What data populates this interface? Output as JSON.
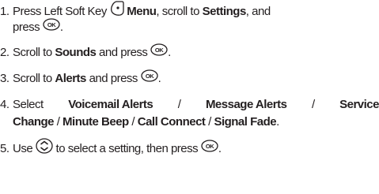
{
  "steps": [
    {
      "num": "1.",
      "t1": "Press Left Soft Key",
      "t2": "Menu",
      "t3": ", scroll to",
      "t4": "Settings",
      "t5": ", and",
      "t6": "press",
      "t7": "."
    },
    {
      "num": "2.",
      "t1": "Scroll to",
      "t2": "Sounds",
      "t3": "and press",
      "t4": "."
    },
    {
      "num": "3.",
      "t1": "Scroll to",
      "t2": "Alerts",
      "t3": "and press",
      "t4": "."
    },
    {
      "num": "4.",
      "t1": "Select",
      "t2": "Voicemail Alerts",
      "t3": "/",
      "t4": "Message Alerts",
      "t5": "/",
      "t6": "Service",
      "t7": "Change",
      "t8": "/",
      "t9": "Minute Beep",
      "t10": "/",
      "t11": "Call Connect",
      "t12": "/",
      "t13": "Signal Fade",
      "t14": "."
    },
    {
      "num": "5.",
      "t1": "Use",
      "t2": "to select a setting, then press",
      "t3": "."
    }
  ],
  "icons": {
    "soft_key": "left-soft-key-icon",
    "ok": "ok-key-icon",
    "nav": "navigation-key-icon",
    "ok_label": "OK"
  }
}
